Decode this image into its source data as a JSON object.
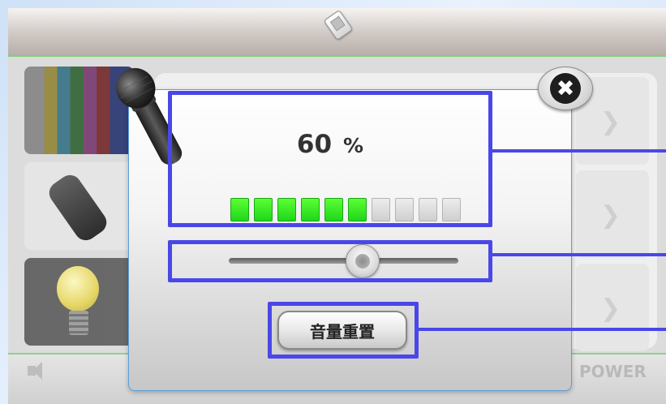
{
  "volume": {
    "value": "60",
    "unit": "%",
    "level_fraction": 0.6,
    "segments_total": 10,
    "segments_on": 6,
    "slider_fraction": 0.58
  },
  "dialog": {
    "reset_label": "音量重置",
    "close_glyph": "✖"
  },
  "bottom_bar": {
    "power_label": "POWER"
  },
  "colors": {
    "highlight": "#4a47e8",
    "meter_on": "#2ee81f",
    "meter_off": "#dcdcdc",
    "dialog_border": "#5d9edd"
  },
  "icons": [
    "phone-icon",
    "microphone-icon",
    "close-icon",
    "speaker-icon",
    "tv-icon",
    "remote-icon",
    "light-bulb-icon",
    "chevron-right-icon"
  ]
}
